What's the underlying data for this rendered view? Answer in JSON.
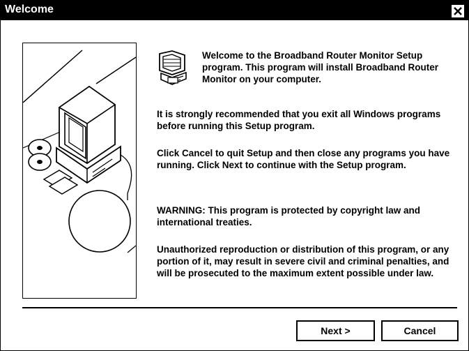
{
  "window": {
    "title": "Welcome"
  },
  "intro": {
    "welcome_text": "Welcome to the Broadband Router Monitor Setup program. This program will install Broadband Router Monitor on your computer."
  },
  "body": {
    "recommendation": "It is strongly recommended that you exit all Windows programs before running this Setup program.",
    "instructions": "Click Cancel to quit Setup and then close any programs you have running. Click Next to continue with the Setup program.",
    "warning": "WARNING: This program is protected by copyright law and international treaties.",
    "legal": "Unauthorized reproduction or distribution of this program, or any portion of it, may result in severe civil and criminal penalties, and will be prosecuted to the maximum extent possible under law."
  },
  "buttons": {
    "next_label": "Next >",
    "cancel_label": "Cancel"
  },
  "icons": {
    "close": "close-icon",
    "setup": "setup-computer-icon",
    "illustration": "computer-illustration"
  }
}
